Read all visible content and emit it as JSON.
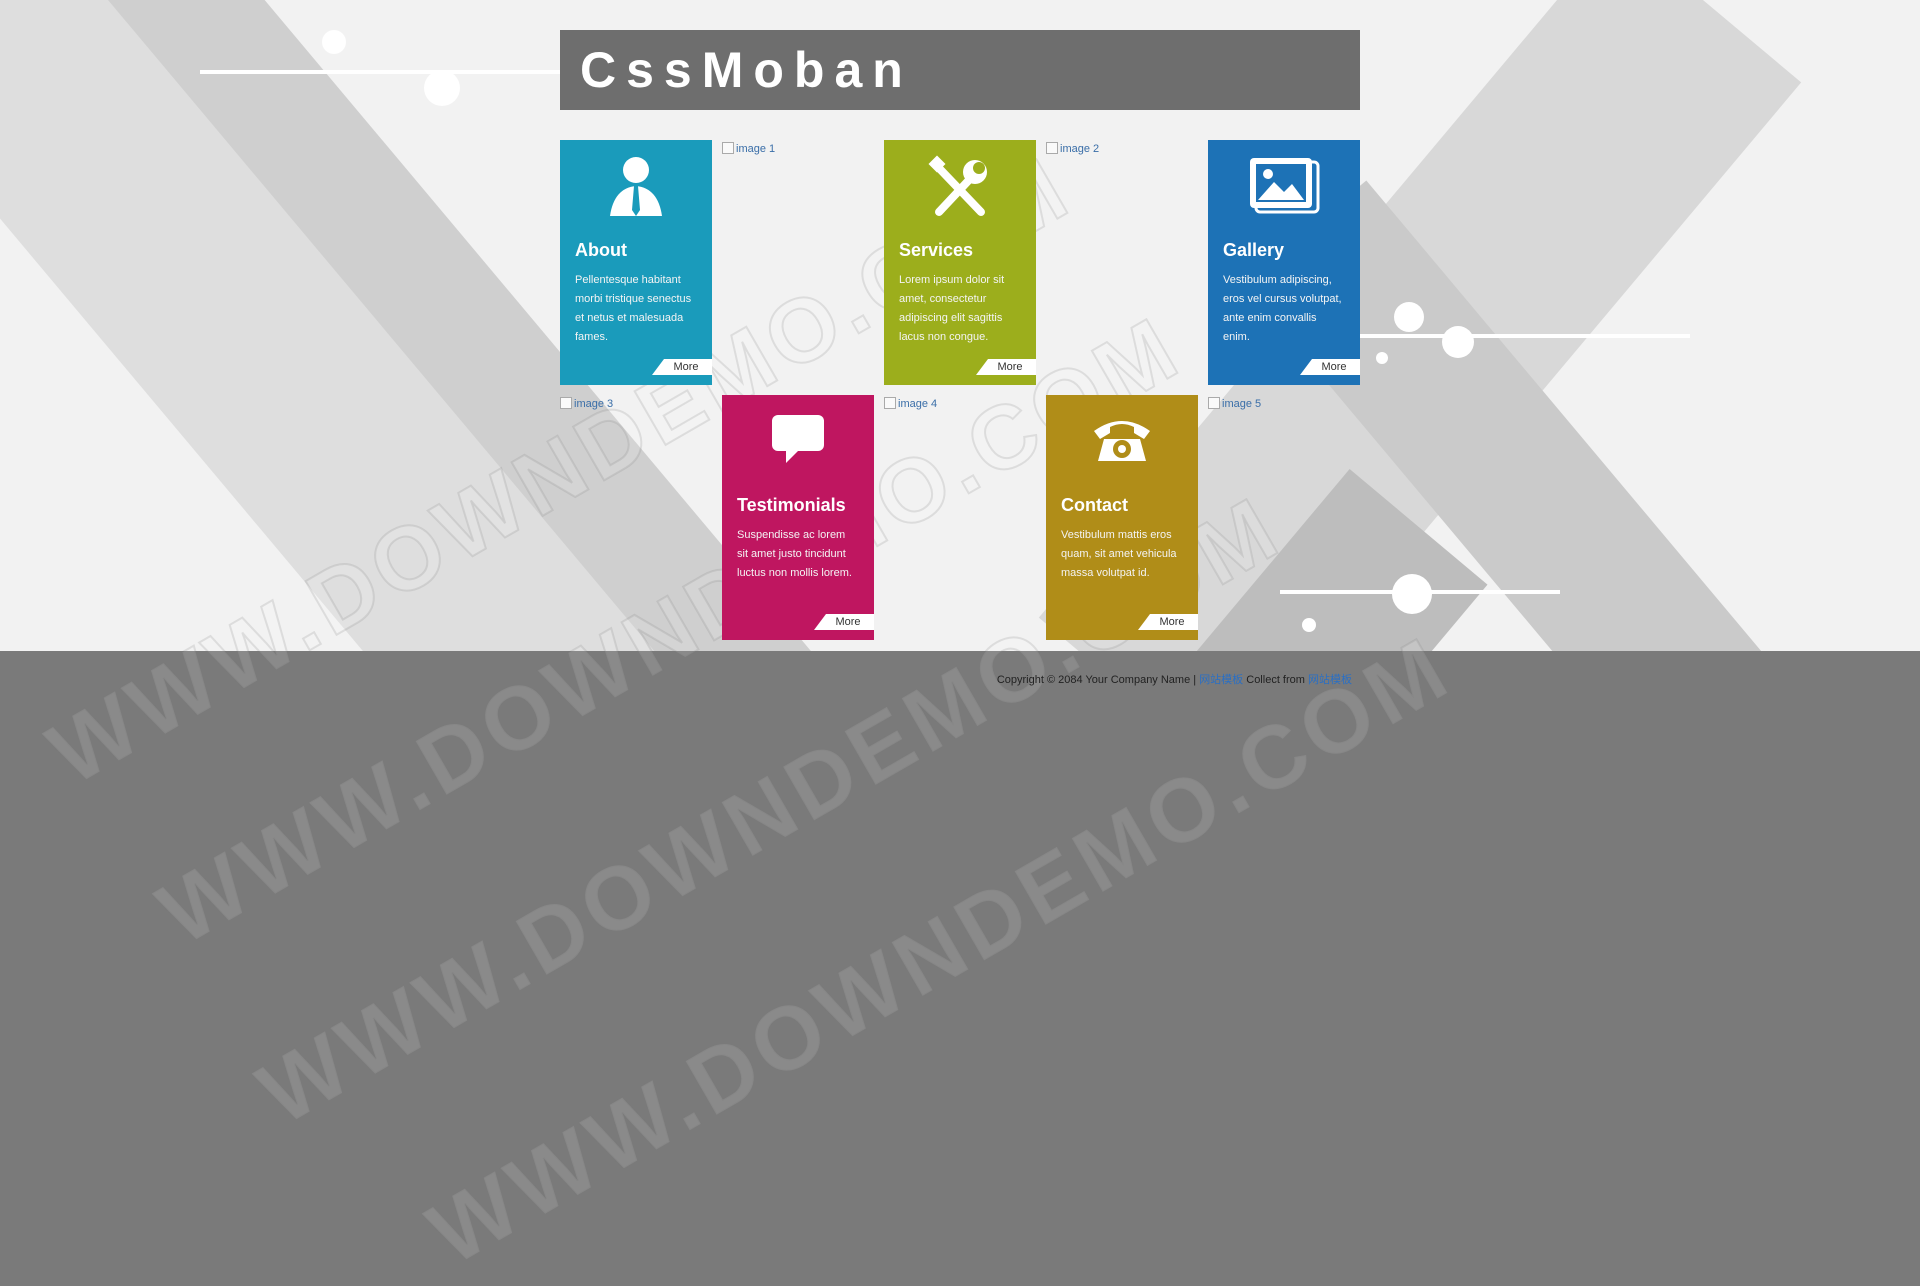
{
  "site": {
    "title": "CssMoban"
  },
  "tiles": [
    {
      "type": "card",
      "title": "About",
      "text": "Pellentesque habitant morbi tristique senectus et netus et malesuada fames.",
      "more": "More",
      "color": "#1a9bbb",
      "icon": "person-icon"
    },
    {
      "type": "image",
      "alt": "image 1"
    },
    {
      "type": "card",
      "title": "Services",
      "text": "Lorem ipsum dolor sit amet, consectetur adipiscing elit sagittis lacus non congue.",
      "more": "More",
      "color": "#9cae1c",
      "icon": "tools-icon"
    },
    {
      "type": "image",
      "alt": "image 2"
    },
    {
      "type": "card",
      "title": "Gallery",
      "text": "Vestibulum adipiscing, eros vel cursus volutpat, ante enim convallis enim.",
      "more": "More",
      "color": "#1d72b6",
      "icon": "picture-icon"
    },
    {
      "type": "image",
      "alt": "image 3"
    },
    {
      "type": "card",
      "title": "Testimonials",
      "text": "Suspendisse ac lorem sit amet justo tincidunt luctus non mollis lorem.",
      "more": "More",
      "color": "#bf1660",
      "icon": "speech-bubble-icon"
    },
    {
      "type": "image",
      "alt": "image 4"
    },
    {
      "type": "card",
      "title": "Contact",
      "text": "Vestibulum mattis eros quam, sit amet vehicula massa volutpat id.",
      "more": "More",
      "color": "#b08d18",
      "icon": "telephone-icon"
    },
    {
      "type": "image",
      "alt": "image 5"
    }
  ],
  "footer": {
    "copyright": "Copyright © 2084 Your Company Name |",
    "link1": "网站模板",
    "collect": "Collect from",
    "link2": "网站模板"
  },
  "watermark": "WWW.DOWNDEMO.COM"
}
